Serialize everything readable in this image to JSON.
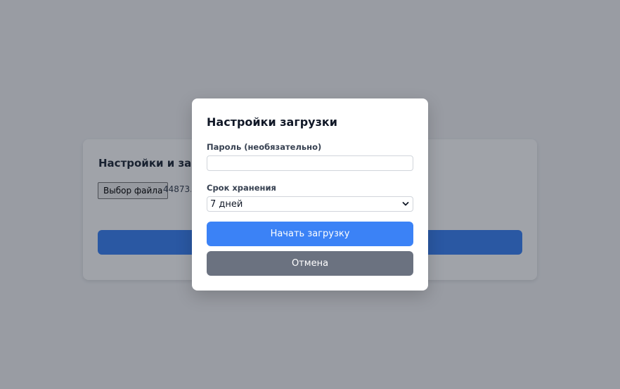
{
  "background_card": {
    "title": "Настройки и загрузка",
    "file_button_label": "Выбор файла",
    "file_name": "44873.K"
  },
  "modal": {
    "title": "Настройки загрузки",
    "password": {
      "label": "Пароль (необязательно)",
      "value": "",
      "placeholder": ""
    },
    "retention": {
      "label": "Срок хранения",
      "selected": "7 дней"
    },
    "start_button_label": "Начать загрузку",
    "cancel_button_label": "Отмена"
  },
  "colors": {
    "primary": "#3b82f6",
    "secondary": "#6b7280",
    "overlay": "rgba(17,24,39,0.40)"
  },
  "icons": {
    "select_chevron": "chevron-down-icon"
  }
}
